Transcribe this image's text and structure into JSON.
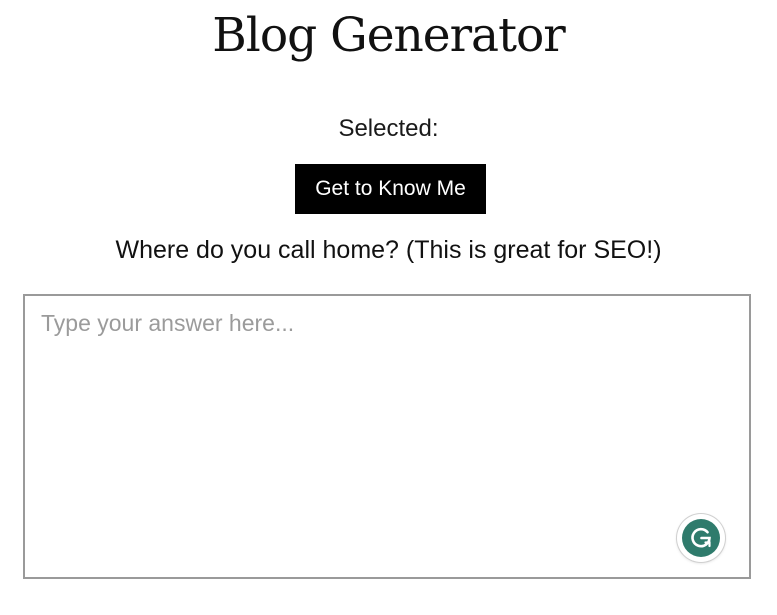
{
  "page": {
    "title": "Blog Generator",
    "selected_label": "Selected:",
    "category_button_label": "Get to Know Me",
    "question": "Where do you call home? (This is great for SEO!)"
  },
  "answer": {
    "value": "",
    "placeholder": "Type your answer here..."
  },
  "icons": {
    "grammarly": "grammarly-icon"
  },
  "colors": {
    "button_bg": "#000000",
    "button_text": "#ffffff",
    "grammarly_green": "#2f7b6c",
    "box_border": "#9a9a9a"
  }
}
